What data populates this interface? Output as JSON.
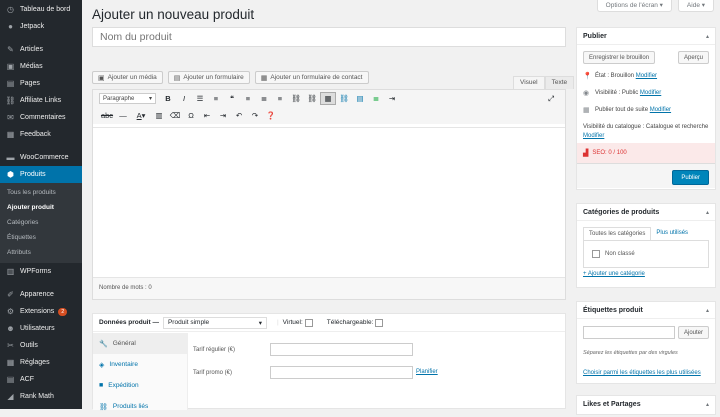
{
  "menu": {
    "items": [
      {
        "icon": "dashboard-icon",
        "glyph": "◷",
        "label": "Tableau de bord"
      },
      {
        "icon": "jetpack-icon",
        "glyph": "●",
        "label": "Jetpack"
      },
      {
        "sep": true
      },
      {
        "icon": "pin-icon",
        "glyph": "✎",
        "label": "Articles"
      },
      {
        "icon": "media-icon",
        "glyph": "▣",
        "label": "Médias"
      },
      {
        "icon": "pages-icon",
        "glyph": "▤",
        "label": "Pages"
      },
      {
        "icon": "link-icon",
        "glyph": "⛓",
        "label": "Affiliate Links"
      },
      {
        "icon": "comments-icon",
        "glyph": "✉",
        "label": "Commentaires"
      },
      {
        "icon": "feedback-icon",
        "glyph": "▦",
        "label": "Feedback"
      },
      {
        "sep": true
      },
      {
        "icon": "woocommerce-icon",
        "glyph": "▬",
        "label": "WooCommerce"
      },
      {
        "icon": "products-icon",
        "glyph": "⬢",
        "label": "Produits",
        "active": true
      },
      {
        "sub": [
          "Tous les produits",
          "Ajouter produit",
          "Catégories",
          "Étiquettes",
          "Attributs"
        ],
        "current": 1
      },
      {
        "icon": "wpforms-icon",
        "glyph": "▥",
        "label": "WPForms"
      },
      {
        "sep": true
      },
      {
        "icon": "appearance-icon",
        "glyph": "✐",
        "label": "Apparence"
      },
      {
        "icon": "plugins-icon",
        "glyph": "⚙",
        "label": "Extensions",
        "badge": "2"
      },
      {
        "icon": "users-icon",
        "glyph": "☻",
        "label": "Utilisateurs"
      },
      {
        "icon": "tools-icon",
        "glyph": "✂",
        "label": "Outils"
      },
      {
        "icon": "settings-icon",
        "glyph": "▦",
        "label": "Réglages"
      },
      {
        "icon": "acf-icon",
        "glyph": "▤",
        "label": "ACF"
      },
      {
        "icon": "rankmath-icon",
        "glyph": "◢",
        "label": "Rank Math"
      }
    ]
  },
  "screen_meta": {
    "options": "Options de l'écran ▾",
    "help": "Aide ▾"
  },
  "page_title": "Ajouter un nouveau produit",
  "post_title_placeholder": "Nom du produit",
  "media_buttons": [
    "Ajouter un média",
    "Ajouter un formulaire",
    "Ajouter un formulaire de contact"
  ],
  "editor_tabs": {
    "visual": "Visuel",
    "text": "Texte"
  },
  "format_select": "Paragraphe",
  "word_count": "Nombre de mots : 0",
  "product_data": {
    "label": "Données produit —",
    "type": "Produit simple",
    "virtual": "Virtuel:",
    "downloadable": "Téléchargeable:",
    "tabs": [
      {
        "icon": "wrench-icon",
        "glyph": "🔧",
        "label": "Général"
      },
      {
        "icon": "tag-icon",
        "glyph": "◈",
        "label": "Inventaire"
      },
      {
        "icon": "truck-icon",
        "glyph": "■",
        "label": "Expédition"
      },
      {
        "icon": "link-icon",
        "glyph": "⛓",
        "label": "Produits liés"
      }
    ],
    "regular_price": "Tarif régulier (€)",
    "sale_price": "Tarif promo (€)",
    "schedule": "Planifier"
  },
  "publish": {
    "title": "Publier",
    "save_draft": "Enregistrer le brouillon",
    "preview": "Aperçu",
    "status_label": "État : Brouillon",
    "visibility_label": "Visibilité : Public",
    "publish_label": "Publier tout de suite",
    "catalog_label": "Visibilité du catalogue : Catalogue et recherche",
    "modify": "Modifier",
    "seo": "SEO: 0 / 100",
    "publish_btn": "Publier"
  },
  "categories": {
    "title": "Catégories de produits",
    "tab_all": "Toutes les catégories",
    "tab_used": "Plus utilisés",
    "item": "Non classé",
    "add": "+ Ajouter une catégorie"
  },
  "tags": {
    "title": "Étiquettes produit",
    "add_btn": "Ajouter",
    "hint": "Séparez les étiquettes par des virgules",
    "choose": "Choisir parmi les étiquettes les plus utilisées"
  },
  "likes": {
    "title": "Likes et Partages"
  }
}
